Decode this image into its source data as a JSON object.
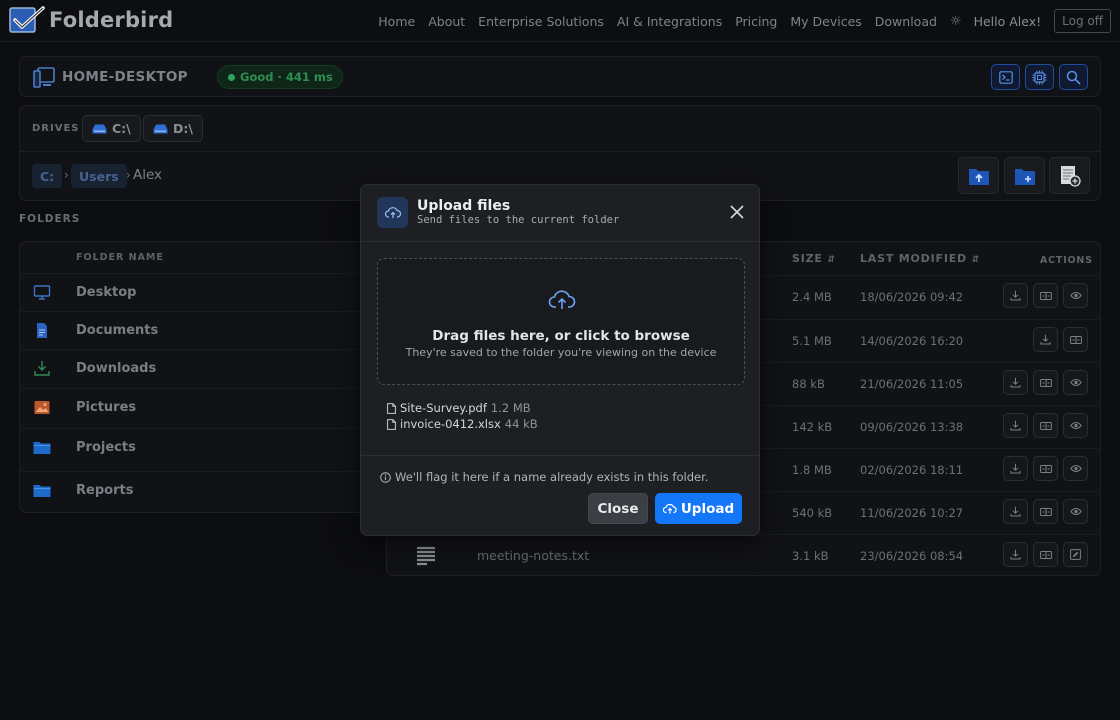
{
  "app": {
    "name": "Folderbird",
    "logo_icon": "checkbox-pen-logo-icon"
  },
  "nav": {
    "links": [
      "Home",
      "About",
      "Enterprise Solutions",
      "AI & Integrations",
      "Pricing",
      "My Devices",
      "Download"
    ],
    "theme_icon": "sun-icon",
    "greeting": "Hello Alex!",
    "logout_label": "Log off"
  },
  "device": {
    "name": "HOME-DESKTOP",
    "status": "Good · 441 ms",
    "status_color": "#2fa35c",
    "tools": [
      "terminal-icon",
      "cpu-icon",
      "search-icon"
    ]
  },
  "drives": {
    "label": "DRIVES",
    "items": [
      {
        "label": "C:\\"
      },
      {
        "label": "D:\\"
      }
    ]
  },
  "breadcrumb": {
    "root": "C:",
    "parent": "Users",
    "current": "Alex",
    "separator": "›"
  },
  "path_actions": [
    "upload-to-folder-icon",
    "new-folder-icon",
    "new-file-icon"
  ],
  "folders": {
    "heading": "FOLDERS",
    "column": "FOLDER NAME",
    "items": [
      {
        "label": "Desktop",
        "icon": "monitor-icon"
      },
      {
        "label": "Documents",
        "icon": "document-icon"
      },
      {
        "label": "Downloads",
        "icon": "download-icon"
      },
      {
        "label": "Pictures",
        "icon": "image-icon"
      },
      {
        "label": "Projects",
        "icon": "folder-icon"
      },
      {
        "label": "Reports",
        "icon": "folder-icon"
      }
    ]
  },
  "files": {
    "columns": {
      "size": "SIZE",
      "modified": "LAST MODIFIED",
      "actions": "ACTIONS"
    },
    "sort_icon": "⇵",
    "rows": [
      {
        "name": "",
        "size": "2.4 MB",
        "modified": "18/06/2026 09:42",
        "actions": [
          "download-icon",
          "compare-icon",
          "view-icon"
        ]
      },
      {
        "name": "",
        "size": "5.1 MB",
        "modified": "14/06/2026 16:20",
        "actions": [
          "download-icon",
          "compare-icon"
        ]
      },
      {
        "name": "",
        "size": "88 kB",
        "modified": "21/06/2026 11:05",
        "actions": [
          "download-icon",
          "compare-icon",
          "view-icon"
        ]
      },
      {
        "name": "",
        "size": "142 kB",
        "modified": "09/06/2026 13:38",
        "actions": [
          "download-icon",
          "compare-icon",
          "view-icon"
        ]
      },
      {
        "name": "",
        "size": "1.8 MB",
        "modified": "02/06/2026 18:11",
        "actions": [
          "download-icon",
          "compare-icon",
          "view-icon"
        ]
      },
      {
        "name": "",
        "size": "540 kB",
        "modified": "11/06/2026 10:27",
        "actions": [
          "download-icon",
          "compare-icon",
          "view-icon"
        ]
      },
      {
        "name": "meeting-notes.txt",
        "size": "3.1 kB",
        "modified": "23/06/2026 08:54",
        "actions": [
          "download-icon",
          "compare-icon",
          "edit-icon"
        ]
      }
    ]
  },
  "modal": {
    "title": "Upload files",
    "subtitle": "Send files to the current folder",
    "dropzone_title": "Drag files here, or click to browse",
    "dropzone_subtitle": "They're saved to the folder you're viewing on the device",
    "selected_files": [
      {
        "name": "Site-Survey.pdf",
        "size": "1.2 MB"
      },
      {
        "name": "invoice-0412.xlsx",
        "size": "44 kB"
      }
    ],
    "note": "We'll flag it here if a name already exists in this folder.",
    "close_label": "Close",
    "upload_label": "Upload",
    "accent": "#1477f8"
  }
}
